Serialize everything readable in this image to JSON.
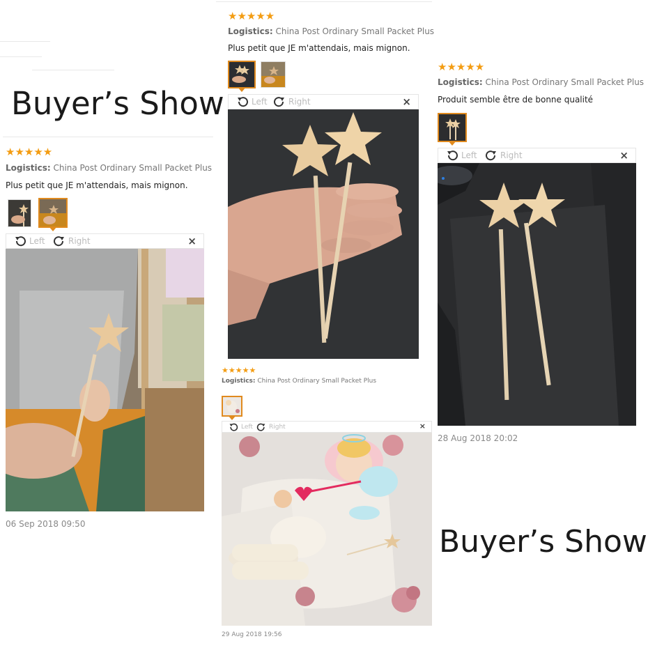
{
  "titles": {
    "top_left": "Buyer’s Show",
    "bottom_right": "Buyer’s Show"
  },
  "colors": {
    "star": "#f39c12",
    "selected": "#e08a1e"
  },
  "reviews": [
    {
      "stars": "★★★★★",
      "logistics_label": "Logistics:",
      "logistics_value": "China Post Ordinary Small Packet Plus",
      "comment": "Plus petit que JE m'attendais, mais mignon.",
      "rotate_left": "Left",
      "rotate_right": "Right",
      "close": "×",
      "date": "06 Sep 2018 09:50"
    },
    {
      "stars": "★★★★★",
      "logistics_label": "Logistics:",
      "logistics_value": "China Post Ordinary Small Packet Plus",
      "comment": "Plus petit que JE m'attendais, mais mignon.",
      "rotate_left": "Left",
      "rotate_right": "Right",
      "close": "×"
    },
    {
      "stars": "★★★★★",
      "logistics_label": "Logistics:",
      "logistics_value": "China Post Ordinary Small Packet Plus",
      "comment": "Produit semble être de bonne qualité",
      "rotate_left": "Left",
      "rotate_right": "Right",
      "close": "×",
      "date": "28 Aug 2018 20:02"
    },
    {
      "stars": "★★★★★",
      "logistics_label": "Logistics:",
      "logistics_value": "China Post Ordinary Small Packet Plus",
      "rotate_left": "Left",
      "rotate_right": "Right",
      "close": "×",
      "date": "29 Aug 2018 19:56"
    }
  ]
}
